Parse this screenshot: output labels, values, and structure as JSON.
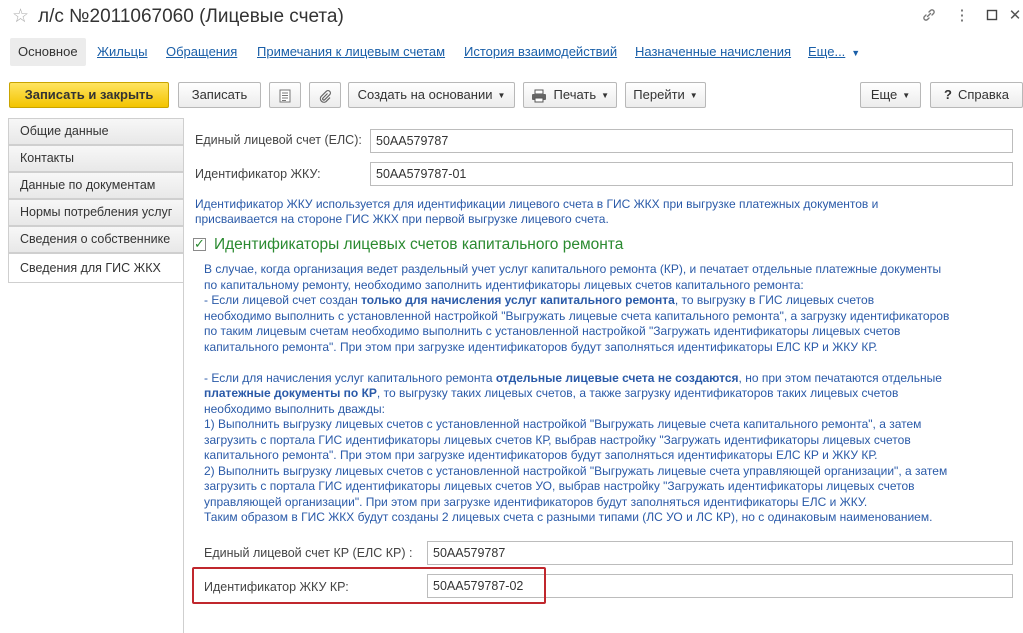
{
  "window": {
    "title": "л/с №2011067060 (Лицевые счета)",
    "star_icon": "star-icon",
    "controls": [
      "link-icon",
      "more-icon",
      "minimize-icon",
      "close-icon"
    ]
  },
  "tabs": {
    "items": [
      "Основное",
      "Жильцы",
      "Обращения",
      "Примечания к лицевым счетам",
      "История взаимодействий",
      "Назначенные начисления"
    ],
    "more_label": "Еще..."
  },
  "toolbar": {
    "save_close": "Записать и закрыть",
    "save": "Записать",
    "create_based": "Создать на основании",
    "print": "Печать",
    "goto": "Перейти",
    "more": "Еще",
    "help_q": "?",
    "help": "Справка"
  },
  "sidebar": {
    "items": [
      "Общие данные",
      "Контакты",
      "Данные по документам",
      "Нормы потребления услуг",
      "Сведения о собственнике",
      "Сведения для ГИС ЖКХ"
    ],
    "active_index": 5
  },
  "form": {
    "els_label": "Единый лицевой счет (ЕЛС):",
    "els_value": "50АА579787",
    "id_label": "Идентификатор ЖКУ:",
    "id_value": "50АА579787-01",
    "info_line1": "Идентификатор ЖКУ используется для идентификации лицевого счета в ГИС ЖКХ при выгрузке платежных документов и",
    "info_line2": "присваивается на стороне ГИС ЖКХ при первой выгрузке лицевого счета.",
    "group_title": "Идентификаторы лицевых счетов капитального ремонта",
    "group_checked": true,
    "desc": {
      "p1_l1": "В случае, когда организация ведет раздельный учет услуг капитального ремонта (КР), и печатает отдельные платежные документы",
      "p1_l2": "по капитальному ремонту, необходимо заполнить идентификаторы лицевых счетов капитального ремонта:",
      "p2_pre": "- Если лицевой счет создан ",
      "p2_bold": "только для начисления услуг капитального ремонта",
      "p2_post": ", то выгрузку в ГИС лицевых счетов",
      "p2_l2": "необходимо выполнить с установленной настройкой \"Выгружать лицевые счета капитального ремонта\", а загрузку идентификаторов",
      "p2_l3": "по таким лицевым счетам необходимо выполнить с установленной настройкой \"Загружать идентификаторы лицевых счетов",
      "p2_l4": "капитального ремонта\". При этом при загрузке идентификаторов будут заполняться идентификаторы ЕЛС КР и ЖКУ КР.",
      "p3_pre": "- Если для начисления услуг капитального ремонта ",
      "p3_bold1": "отдельные лицевые счета не создаются",
      "p3_mid": ", но при этом печатаются отдельные",
      "p3_bold2": "платежные документы по КР",
      "p3_post": ", то выгрузку таких лицевых счетов, а также загрузку идентификаторов таких лицевых счетов",
      "p3_l3": "необходимо выполнить дважды:",
      "p3_l4": "1) Выполнить выгрузку лицевых счетов с установленной настройкой \"Выгружать лицевые счета капитального ремонта\", а затем",
      "p3_l5": "загрузить с портала ГИС идентификаторы лицевых счетов КР, выбрав настройку \"Загружать идентификаторы лицевых счетов",
      "p3_l6": "капитального ремонта\". При этом при загрузке идентификаторов будут заполняться идентификаторы ЕЛС КР и ЖКУ КР.",
      "p3_l7": "2) Выполнить выгрузку лицевых счетов с установленной настройкой \"Выгружать лицевые счета управляющей организации\", а затем",
      "p3_l8": "загрузить с портала ГИС идентификаторы лицевых счетов УО, выбрав настройку \"Загружать идентификаторы лицевых счетов",
      "p3_l9": "управляющей организации\". При этом при загрузке идентификаторов будут заполняться идентификаторы ЕЛС и ЖКУ.",
      "p3_l10": "Таким образом в ГИС ЖКХ будут созданы 2 лицевых счета с разными типами (ЛС УО и ЛС КР), но с одинаковым наименованием."
    },
    "els_kr_label": "Единый лицевой счет КР (ЕЛС КР) :",
    "els_kr_value": "50АА579787",
    "id_kr_label": "Идентификатор ЖКУ КР:",
    "id_kr_value": "50АА579787-02"
  },
  "colors": {
    "primary_button": "#f3c400",
    "link": "#1a5fa8",
    "info_text": "#2a5aa8",
    "group_title": "#2a8a30",
    "highlight_border": "#c0272d"
  }
}
